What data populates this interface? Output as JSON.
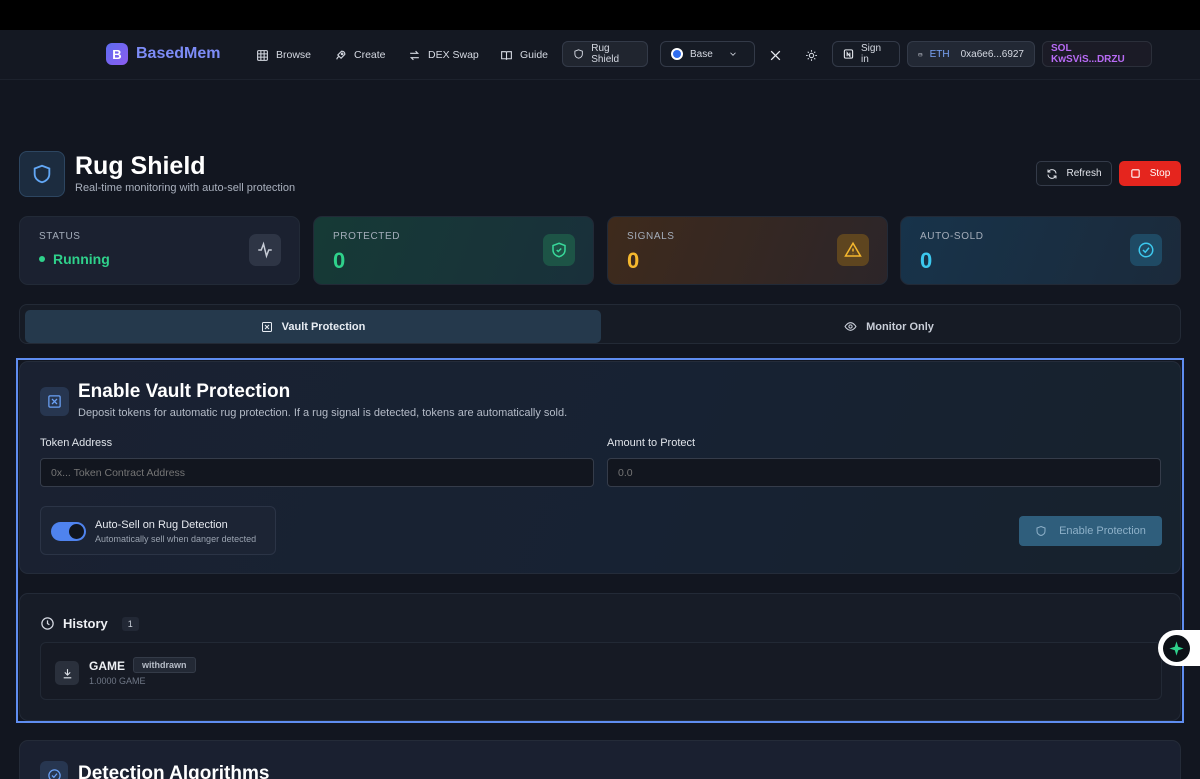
{
  "brand": {
    "logo_letter": "B",
    "name": "BasedMem"
  },
  "nav": {
    "items": [
      {
        "label": "Browse",
        "icon": "grid-icon"
      },
      {
        "label": "Create",
        "icon": "rocket-icon"
      },
      {
        "label": "DEX Swap",
        "icon": "swap-icon"
      },
      {
        "label": "Guide",
        "icon": "book-icon"
      },
      {
        "label": "Rug Shield",
        "icon": "shield-icon"
      }
    ],
    "chain": "Base",
    "sign_in": "Sign in",
    "eth_label": "ETH",
    "eth_address": "0xa6e6...6927",
    "sol_wallet": "SOL KwSViS...DRZU"
  },
  "page": {
    "title": "Rug Shield",
    "subtitle": "Real-time monitoring with auto-sell protection",
    "refresh_label": "Refresh",
    "stop_label": "Stop"
  },
  "stats": [
    {
      "label": "STATUS",
      "value": "Running",
      "icon": "activity-icon",
      "color": "#2fd18b"
    },
    {
      "label": "PROTECTED",
      "value": "0",
      "icon": "shield-check-icon",
      "color": "#2fd18b"
    },
    {
      "label": "SIGNALS",
      "value": "0",
      "icon": "warning-icon",
      "color": "#f5b82e"
    },
    {
      "label": "AUTO-SOLD",
      "value": "0",
      "icon": "check-circle-icon",
      "color": "#3cc8ee"
    }
  ],
  "tabs": {
    "vault": "Vault Protection",
    "monitor": "Monitor Only"
  },
  "vault": {
    "title": "Enable Vault Protection",
    "description": "Deposit tokens for automatic rug protection. If a rug signal is detected, tokens are automatically sold.",
    "token_label": "Token Address",
    "token_placeholder": "0x... Token Contract Address",
    "amount_label": "Amount to Protect",
    "amount_placeholder": "0.0",
    "toggle_title": "Auto-Sell on Rug Detection",
    "toggle_sub": "Automatically sell when danger detected",
    "toggle_on": true,
    "enable_label": "Enable Protection"
  },
  "history": {
    "title": "History",
    "count": "1",
    "rows": [
      {
        "name": "GAME",
        "badge": "withdrawn",
        "amount": "1.0000 GAME"
      }
    ]
  },
  "algorithms": {
    "title": "Detection Algorithms"
  },
  "colors": {
    "accent": "#4f83ee",
    "stop": "#e5251e",
    "brand": "#7d8cf7",
    "sol": "#b86bf5"
  }
}
